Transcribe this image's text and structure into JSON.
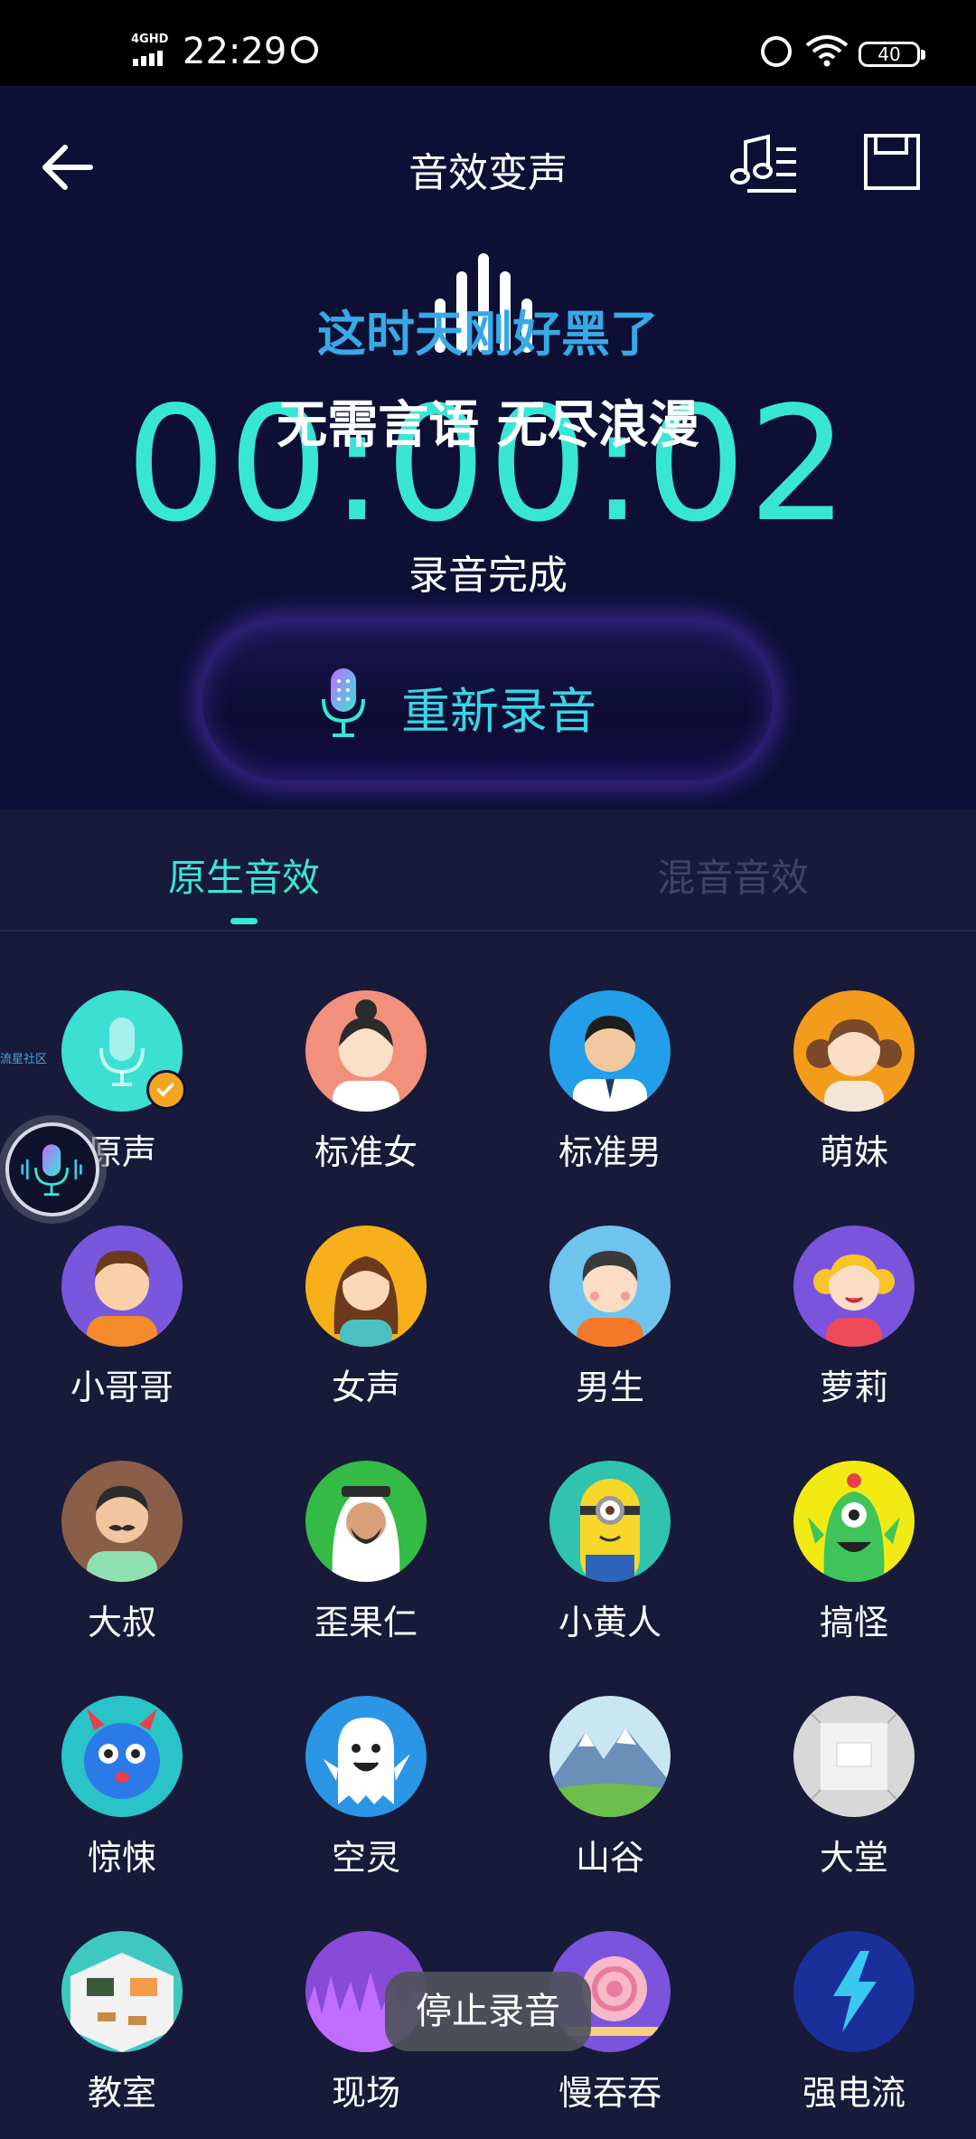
{
  "status_bar": {
    "network": "4GHD",
    "time": "22:29",
    "battery": "40"
  },
  "header": {
    "title": "音效变声",
    "lyric_line1": "这时天刚好黑了",
    "lyric_line2": "无需言语 无尽浪漫",
    "timer": "00:00:02",
    "status": "录音完成",
    "rerecord_label": "重新录音"
  },
  "tabs": [
    {
      "label": "原生音效",
      "active": true
    },
    {
      "label": "混音音效",
      "active": false
    }
  ],
  "effects": [
    {
      "label": "原声",
      "selected": true,
      "icon": "microphone-icon"
    },
    {
      "label": "标准女",
      "icon": "woman-avatar-icon"
    },
    {
      "label": "标准男",
      "icon": "man-avatar-icon"
    },
    {
      "label": "萌妹",
      "icon": "girl-pigtails-avatar-icon"
    },
    {
      "label": "小哥哥",
      "icon": "boy-avatar-icon"
    },
    {
      "label": "女声",
      "icon": "woman-long-hair-avatar-icon"
    },
    {
      "label": "男生",
      "icon": "kid-boy-avatar-icon"
    },
    {
      "label": "萝莉",
      "icon": "little-girl-avatar-icon"
    },
    {
      "label": "大叔",
      "icon": "mustache-man-avatar-icon"
    },
    {
      "label": "歪果仁",
      "icon": "arab-man-avatar-icon"
    },
    {
      "label": "小黄人",
      "icon": "minion-avatar-icon"
    },
    {
      "label": "搞怪",
      "icon": "green-monster-icon"
    },
    {
      "label": "惊悚",
      "icon": "blue-monster-icon"
    },
    {
      "label": "空灵",
      "icon": "ghost-icon"
    },
    {
      "label": "山谷",
      "icon": "mountain-valley-icon"
    },
    {
      "label": "大堂",
      "icon": "hall-room-icon"
    },
    {
      "label": "教室",
      "icon": "classroom-icon"
    },
    {
      "label": "现场",
      "icon": "concert-crowd-icon"
    },
    {
      "label": "慢吞吞",
      "icon": "snail-icon"
    },
    {
      "label": "强电流",
      "icon": "lightning-icon"
    }
  ],
  "side_label": "流星社区",
  "toast": "停止录音",
  "colors": {
    "accent": "#38e6d6",
    "lyric": "#37a9e6",
    "background": "#181a3a",
    "header_bg": "#0d0f35",
    "check": "#f4a51f"
  }
}
